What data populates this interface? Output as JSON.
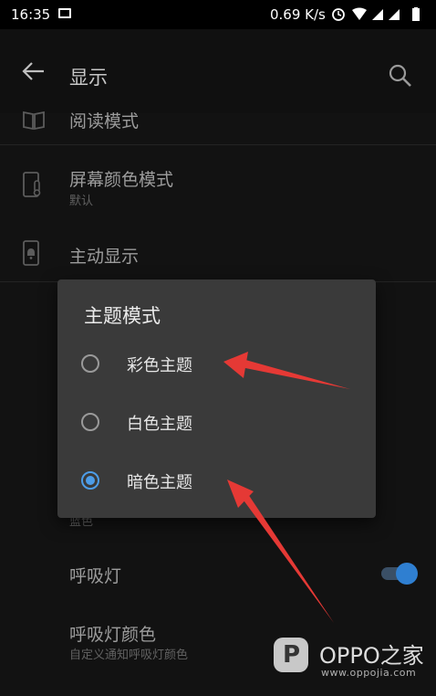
{
  "status_bar": {
    "time": "16:35",
    "network_speed": "0.69 K/s",
    "icons": [
      "image-icon",
      "alarm-icon",
      "wifi-icon",
      "signal-icon",
      "signal-icon",
      "battery-icon"
    ]
  },
  "app_bar": {
    "title": "显示",
    "back_icon": "back-arrow-icon",
    "search_icon": "search-icon"
  },
  "list": {
    "items": [
      {
        "title": "阅读模式",
        "icon": "book-icon"
      },
      {
        "title": "屏幕颜色模式",
        "subtitle": "默认",
        "icon": "phone-thermometer-icon"
      },
      {
        "title": "主动显示",
        "icon": "phone-ambient-icon"
      },
      {
        "subtitle": "蓝色"
      },
      {
        "title": "呼吸灯",
        "toggle_on": true
      },
      {
        "title": "呼吸灯颜色",
        "subtitle": "自定义通知呼吸灯颜色"
      }
    ]
  },
  "dialog": {
    "title": "主题模式",
    "options": [
      {
        "label": "彩色主题",
        "selected": false
      },
      {
        "label": "白色主题",
        "selected": false
      },
      {
        "label": "暗色主题",
        "selected": true
      }
    ]
  },
  "annotations": {
    "arrow_color": "#e53935"
  },
  "watermark": {
    "logo_letter": "P",
    "brand": "OPPO之家",
    "url": "www.oppojia.com"
  },
  "colors": {
    "accent": "#4d9de8",
    "dialog_bg": "#3a3a3a",
    "background": "#121212"
  }
}
